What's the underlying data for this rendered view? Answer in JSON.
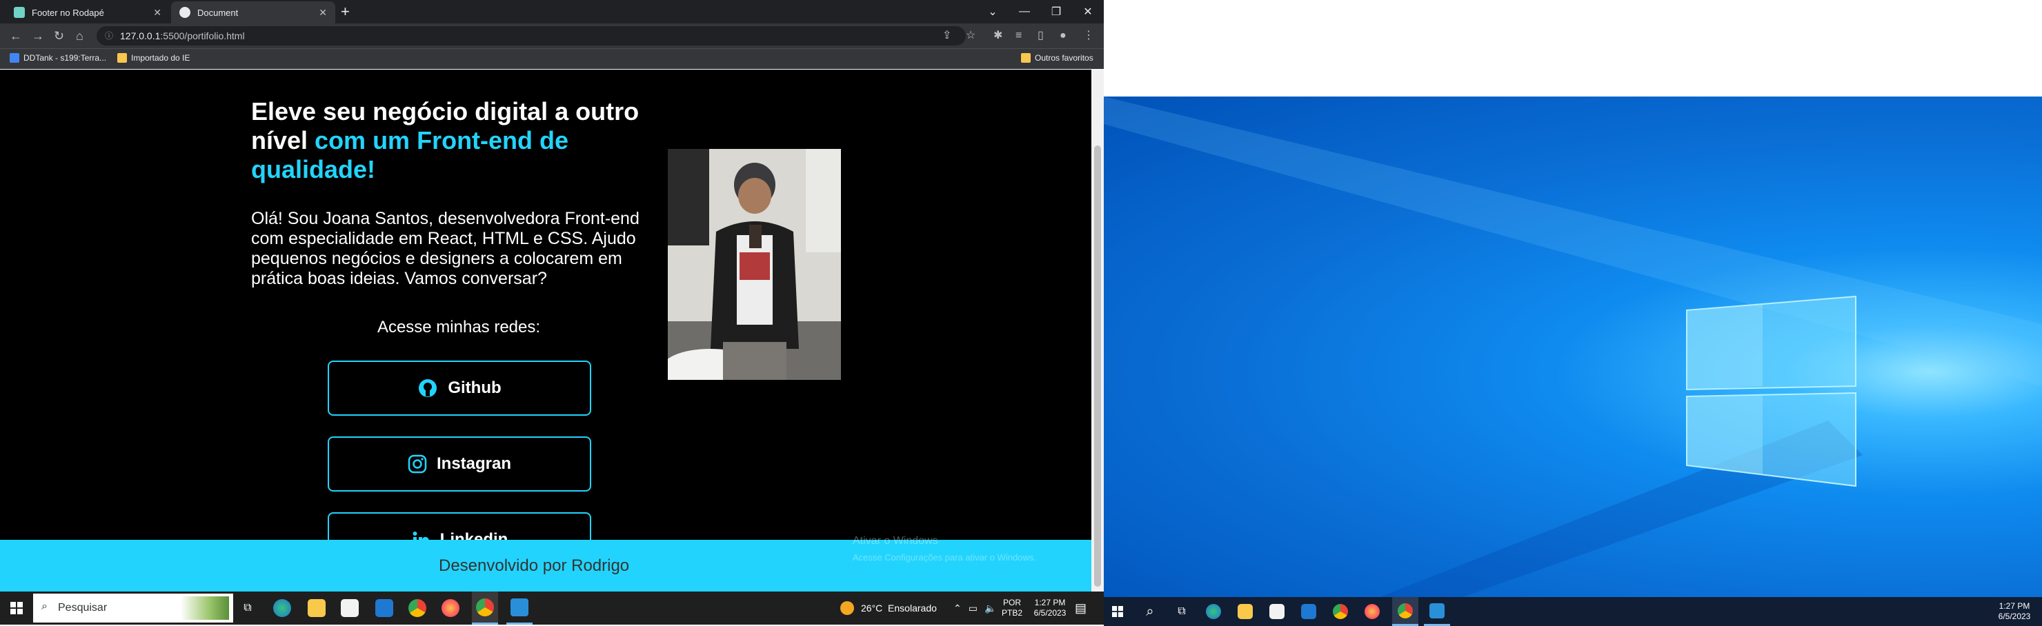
{
  "browser": {
    "tabs": [
      {
        "title": "Footer no Rodapé",
        "active": false,
        "favicon_color": "#6fd3c8"
      },
      {
        "title": "Document",
        "active": true,
        "favicon_color": "#e8eaed"
      }
    ],
    "url_host": "127.0.0.1",
    "url_rest": ":5500/portifolio.html",
    "bookmarks": [
      "DDTank - s199:Terra...",
      "Importado do IE"
    ],
    "other_bookmarks": "Outros favoritos"
  },
  "page": {
    "headline_plain": "Eleve seu negócio digital a outro nível ",
    "headline_highlight": "com um Front-end de qualidade!",
    "intro": "Olá! Sou Joana Santos, desenvolvedora Front-end com especialidade em React, HTML e CSS. Ajudo pequenos negócios e designers a colocarem em prática boas ideias. Vamos conversar?",
    "social_title": "Acesse minhas redes:",
    "social_buttons": [
      "Github",
      "Instagran",
      "Linkedin"
    ],
    "footer_text": "Desenvolvido por Rodrigo",
    "activation_line1": "Ativar o Windows",
    "activation_line2": "Acesse Configurações para ativar o Windows.",
    "accent_color": "#22d4fd"
  },
  "taskbar_left": {
    "search_placeholder": "Pesquisar",
    "weather": "26°C  Ensolarado",
    "lang_line1": "POR",
    "lang_line2": "PTB2",
    "time": "1:27 PM",
    "date": "6/5/2023"
  },
  "taskbar_right": {
    "time": "1:27 PM",
    "date": "6/5/2023"
  }
}
